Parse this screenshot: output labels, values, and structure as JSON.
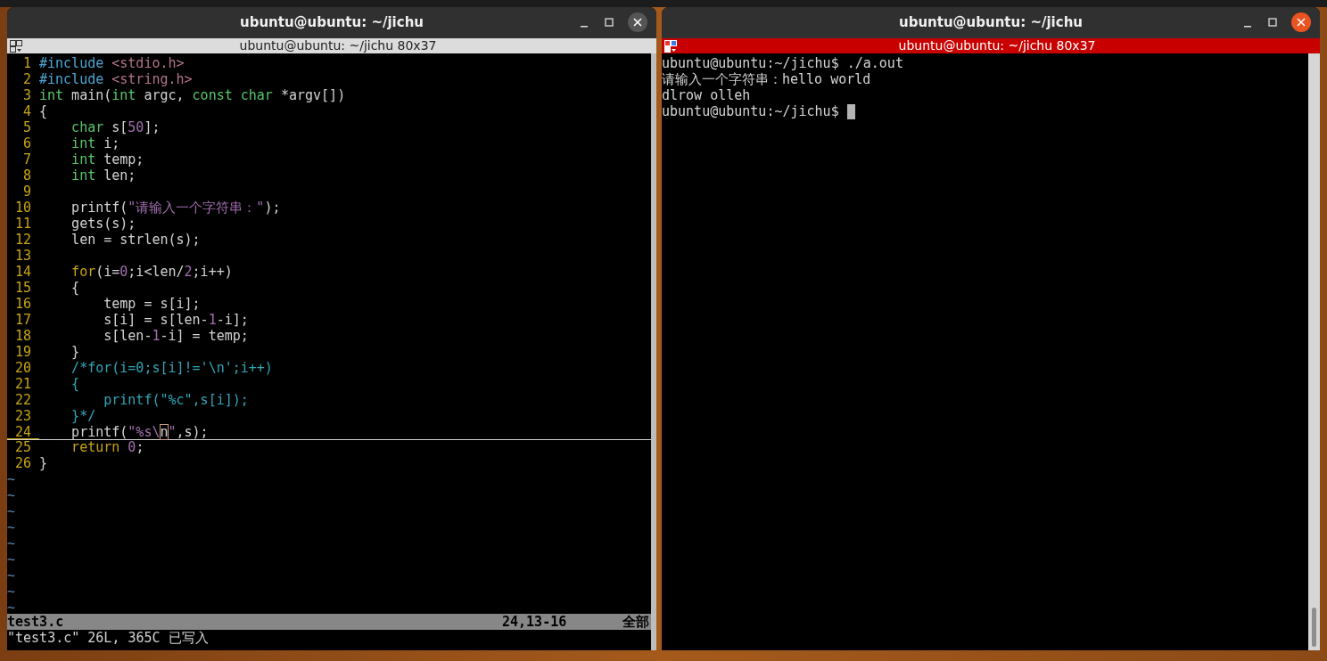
{
  "windows": [
    {
      "kind": "vim",
      "title": "ubuntu@ubuntu: ~/jichu",
      "focused": false,
      "tab_title": "ubuntu@ubuntu: ~/jichu 80x37",
      "lines": [
        {
          "number": "1",
          "current": false,
          "tokens": [
            {
              "kind": "pre",
              "text": "#include "
            },
            {
              "kind": "inc",
              "text": "<stdio.h>"
            }
          ]
        },
        {
          "number": "2",
          "current": false,
          "tokens": [
            {
              "kind": "pre",
              "text": "#include "
            },
            {
              "kind": "inc",
              "text": "<string.h>"
            }
          ]
        },
        {
          "number": "3",
          "current": false,
          "tokens": [
            {
              "kind": "type",
              "text": "int"
            },
            {
              "kind": "plain",
              "text": " main("
            },
            {
              "kind": "type",
              "text": "int"
            },
            {
              "kind": "plain",
              "text": " argc, "
            },
            {
              "kind": "type",
              "text": "const "
            },
            {
              "kind": "type",
              "text": "char"
            },
            {
              "kind": "plain",
              "text": " *argv[])"
            }
          ]
        },
        {
          "number": "4",
          "current": false,
          "tokens": [
            {
              "kind": "plain",
              "text": "{"
            }
          ]
        },
        {
          "number": "5",
          "current": false,
          "tokens": [
            {
              "kind": "type",
              "text": "    char"
            },
            {
              "kind": "plain",
              "text": " s["
            },
            {
              "kind": "num",
              "text": "50"
            },
            {
              "kind": "plain",
              "text": "];"
            }
          ]
        },
        {
          "number": "6",
          "current": false,
          "tokens": [
            {
              "kind": "type",
              "text": "    int"
            },
            {
              "kind": "plain",
              "text": " i;"
            }
          ]
        },
        {
          "number": "7",
          "current": false,
          "tokens": [
            {
              "kind": "type",
              "text": "    int"
            },
            {
              "kind": "plain",
              "text": " temp;"
            }
          ]
        },
        {
          "number": "8",
          "current": false,
          "tokens": [
            {
              "kind": "type",
              "text": "    int"
            },
            {
              "kind": "plain",
              "text": " len;"
            }
          ]
        },
        {
          "number": "9",
          "current": false
        },
        {
          "number": "10",
          "current": false,
          "tokens": [
            {
              "kind": "plain",
              "text": "    printf("
            },
            {
              "kind": "str",
              "text": "\"请输入一个字符串：\""
            },
            {
              "kind": "plain",
              "text": ");"
            }
          ]
        },
        {
          "number": "11",
          "current": false,
          "tokens": [
            {
              "kind": "plain",
              "text": "    gets(s);"
            }
          ]
        },
        {
          "number": "12",
          "current": false,
          "tokens": [
            {
              "kind": "plain",
              "text": "    len = strlen(s);"
            }
          ]
        },
        {
          "number": "13",
          "current": false
        },
        {
          "number": "14",
          "current": false,
          "tokens": [
            {
              "kind": "ctrl",
              "text": "    for"
            },
            {
              "kind": "plain",
              "text": "(i="
            },
            {
              "kind": "num",
              "text": "0"
            },
            {
              "kind": "plain",
              "text": ";i<len/"
            },
            {
              "kind": "num",
              "text": "2"
            },
            {
              "kind": "plain",
              "text": ";i++)"
            }
          ]
        },
        {
          "number": "15",
          "current": false,
          "tokens": [
            {
              "kind": "plain",
              "text": "    {"
            }
          ]
        },
        {
          "number": "16",
          "current": false,
          "tokens": [
            {
              "kind": "plain",
              "text": "        temp = s[i];"
            }
          ]
        },
        {
          "number": "17",
          "current": false,
          "tokens": [
            {
              "kind": "plain",
              "text": "        s[i] = s[len-"
            },
            {
              "kind": "num",
              "text": "1"
            },
            {
              "kind": "plain",
              "text": "-i];"
            }
          ]
        },
        {
          "number": "18",
          "current": false,
          "tokens": [
            {
              "kind": "plain",
              "text": "        s[len-"
            },
            {
              "kind": "num",
              "text": "1"
            },
            {
              "kind": "plain",
              "text": "-i] = temp;"
            }
          ]
        },
        {
          "number": "19",
          "current": false,
          "tokens": [
            {
              "kind": "plain",
              "text": "    }"
            }
          ]
        },
        {
          "number": "20",
          "current": false,
          "tokens": [
            {
              "kind": "com",
              "text": "    /*for(i=0;s[i]!='\\n';i++)"
            }
          ]
        },
        {
          "number": "21",
          "current": false,
          "tokens": [
            {
              "kind": "com",
              "text": "    {"
            }
          ]
        },
        {
          "number": "22",
          "current": false,
          "tokens": [
            {
              "kind": "com",
              "text": "        printf(\"%c\",s[i]);"
            }
          ]
        },
        {
          "number": "23",
          "current": false,
          "tokens": [
            {
              "kind": "com",
              "text": "    }*/"
            }
          ]
        },
        {
          "number": "24",
          "current": true,
          "tokens": [
            {
              "kind": "plain",
              "text": "    printf("
            },
            {
              "kind": "str",
              "text": "\"%s\\"
            },
            {
              "kind": "cursor",
              "text": "n"
            },
            {
              "kind": "str",
              "text": "\""
            },
            {
              "kind": "plain",
              "text": ",s);"
            }
          ]
        },
        {
          "number": "25",
          "current": false,
          "tokens": [
            {
              "kind": "ctrl",
              "text": "    return "
            },
            {
              "kind": "num",
              "text": "0"
            },
            {
              "kind": "plain",
              "text": ";"
            }
          ]
        },
        {
          "number": "26",
          "current": false,
          "tokens": [
            {
              "kind": "plain",
              "text": "}"
            }
          ]
        }
      ],
      "tildes": [
        "~",
        "~",
        "~",
        "~",
        "~",
        "~",
        "~",
        "~",
        "~"
      ],
      "status": {
        "file": "test3.c",
        "position": "24,13-16",
        "scroll": "全部"
      },
      "message": "\"test3.c\" 26L, 365C 已写入"
    },
    {
      "kind": "shell",
      "title": "ubuntu@ubuntu: ~/jichu",
      "focused": true,
      "tab_title": "ubuntu@ubuntu: ~/jichu 80x37",
      "output": [
        {
          "text": "ubuntu@ubuntu:~/jichu$ ./a.out",
          "cursor": false
        },
        {
          "text": "请输入一个字符串：hello world",
          "cursor": false
        },
        {
          "text": "dlrow olleh",
          "cursor": false
        },
        {
          "text": "ubuntu@ubuntu:~/jichu$",
          "cursor": true
        }
      ]
    }
  ]
}
